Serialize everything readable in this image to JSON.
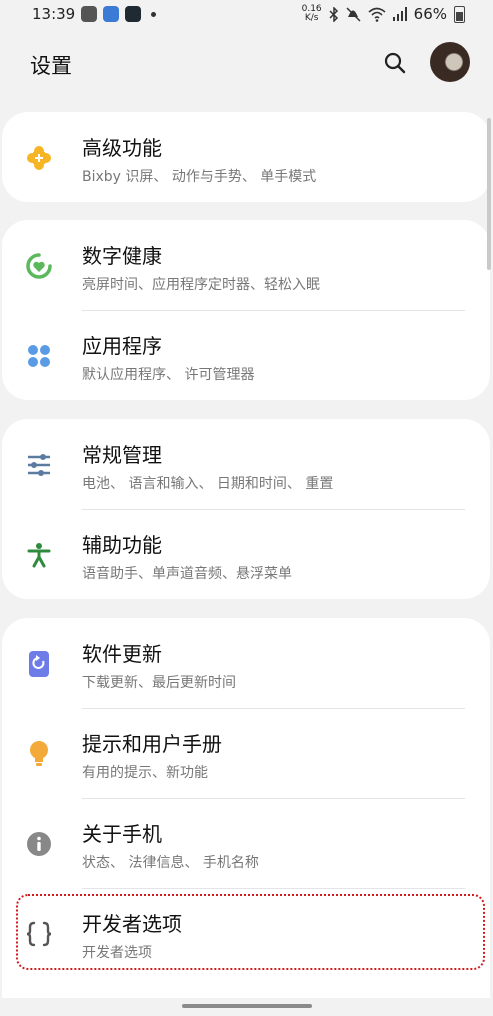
{
  "status_bar": {
    "time": "13:39",
    "net_speed_value": "0.16",
    "net_speed_unit": "K/s",
    "battery": "66%"
  },
  "header": {
    "title": "设置"
  },
  "colors": {
    "advanced": "#f6b524",
    "wellbeing": "#5cb85c",
    "apps": "#5a9be6",
    "general": "#5b7ba0",
    "accessibility": "#2e8b3e",
    "update": "#6e7ce8",
    "tips": "#f4a93b",
    "about": "#888888",
    "dev": "#555555"
  },
  "items": [
    {
      "title": "高级功能",
      "subtitle": "Bixby 识屏、 动作与手势、 单手模式",
      "icon": "plus-puzzle-icon"
    },
    {
      "title": "数字健康",
      "subtitle": "亮屏时间、应用程序定时器、轻松入眠",
      "icon": "wellbeing-icon"
    },
    {
      "title": "应用程序",
      "subtitle": "默认应用程序、 许可管理器",
      "icon": "apps-icon"
    },
    {
      "title": "常规管理",
      "subtitle": "电池、 语言和输入、 日期和时间、 重置",
      "icon": "sliders-icon"
    },
    {
      "title": "辅助功能",
      "subtitle": "语音助手、单声道音频、悬浮菜单",
      "icon": "accessibility-icon"
    },
    {
      "title": "软件更新",
      "subtitle": "下载更新、最后更新时间",
      "icon": "software-update-icon"
    },
    {
      "title": "提示和用户手册",
      "subtitle": "有用的提示、新功能",
      "icon": "lightbulb-icon"
    },
    {
      "title": "关于手机",
      "subtitle": "状态、 法律信息、 手机名称",
      "icon": "info-icon"
    },
    {
      "title": "开发者选项",
      "subtitle": "开发者选项",
      "icon": "braces-icon"
    }
  ]
}
